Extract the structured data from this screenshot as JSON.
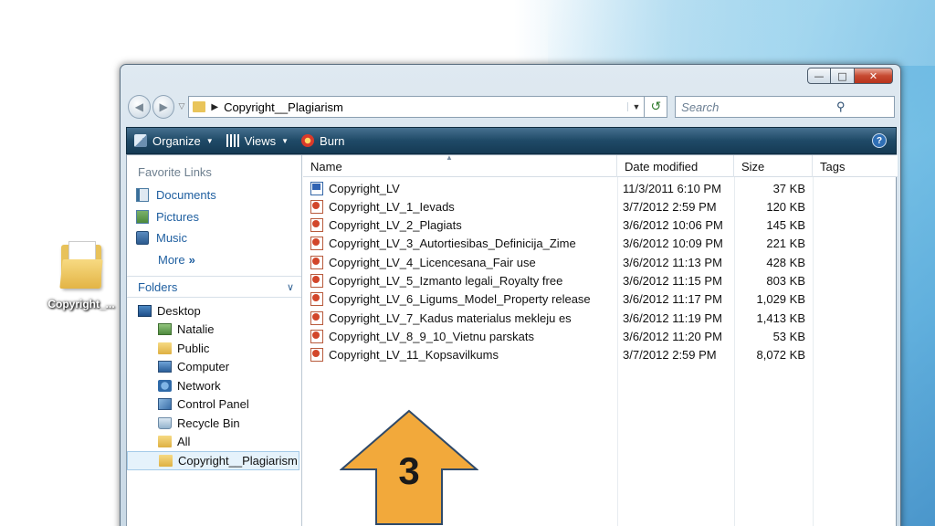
{
  "desktop": {
    "icon_label": "Copyright_..."
  },
  "window": {
    "address": {
      "path": "Copyright__Plagiarism"
    },
    "search": {
      "placeholder": "Search"
    },
    "toolbar": {
      "organize": "Organize",
      "views": "Views",
      "burn": "Burn"
    },
    "nav": {
      "favorite_links_label": "Favorite Links",
      "favorites": [
        "Documents",
        "Pictures",
        "Music"
      ],
      "more_label": "More",
      "folders_label": "Folders",
      "tree": [
        {
          "label": "Desktop",
          "icon": "desktop-icon",
          "level": 0
        },
        {
          "label": "Natalie",
          "icon": "user-folder-icon",
          "level": 1
        },
        {
          "label": "Public",
          "icon": "folder-icon",
          "level": 1
        },
        {
          "label": "Computer",
          "icon": "computer-icon",
          "level": 1
        },
        {
          "label": "Network",
          "icon": "network-icon",
          "level": 1
        },
        {
          "label": "Control Panel",
          "icon": "control-panel-icon",
          "level": 1
        },
        {
          "label": "Recycle Bin",
          "icon": "recycle-bin-icon",
          "level": 1
        },
        {
          "label": "All",
          "icon": "folder-icon",
          "level": 1
        },
        {
          "label": "Copyright__Plagiarism",
          "icon": "folder-icon",
          "level": 1,
          "selected": true
        }
      ]
    },
    "columns": {
      "name": "Name",
      "date": "Date modified",
      "size": "Size",
      "tags": "Tags"
    },
    "files": [
      {
        "name": "Copyright_LV",
        "date": "11/3/2011 6:10 PM",
        "size": "37 KB",
        "type": "doc"
      },
      {
        "name": "Copyright_LV_1_Ievads",
        "date": "3/7/2012 2:59 PM",
        "size": "120 KB",
        "type": "ppt"
      },
      {
        "name": "Copyright_LV_2_Plagiats",
        "date": "3/6/2012 10:06 PM",
        "size": "145 KB",
        "type": "ppt"
      },
      {
        "name": "Copyright_LV_3_Autortiesibas_Definicija_Zime",
        "date": "3/6/2012 10:09 PM",
        "size": "221 KB",
        "type": "ppt"
      },
      {
        "name": "Copyright_LV_4_Licencesana_Fair use",
        "date": "3/6/2012 11:13 PM",
        "size": "428 KB",
        "type": "ppt"
      },
      {
        "name": "Copyright_LV_5_Izmanto legali_Royalty free",
        "date": "3/6/2012 11:15 PM",
        "size": "803 KB",
        "type": "ppt"
      },
      {
        "name": "Copyright_LV_6_Ligums_Model_Property release",
        "date": "3/6/2012 11:17 PM",
        "size": "1,029 KB",
        "type": "ppt"
      },
      {
        "name": "Copyright_LV_7_Kadus materialus mekleju es",
        "date": "3/6/2012 11:19 PM",
        "size": "1,413 KB",
        "type": "ppt"
      },
      {
        "name": "Copyright_LV_8_9_10_Vietnu parskats",
        "date": "3/6/2012 11:20 PM",
        "size": "53 KB",
        "type": "ppt"
      },
      {
        "name": "Copyright_LV_11_Kopsavilkums",
        "date": "3/7/2012 2:59 PM",
        "size": "8,072 KB",
        "type": "ppt"
      }
    ]
  },
  "annotation": {
    "step_number": "3",
    "arrow_color": "#f2a93b"
  }
}
